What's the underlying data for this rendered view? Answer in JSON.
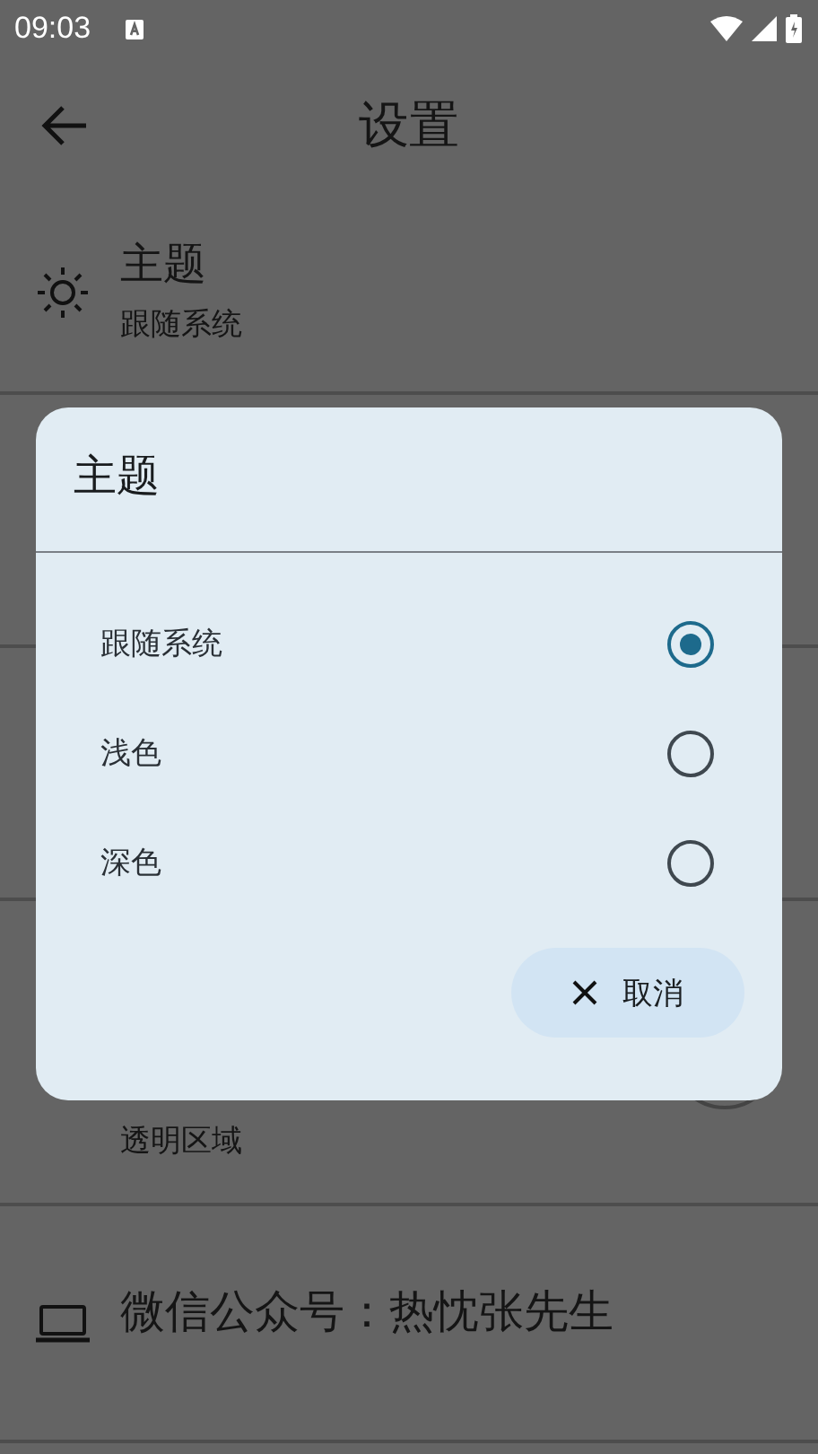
{
  "status_bar": {
    "time": "09:03"
  },
  "app_bar": {
    "title": "设置"
  },
  "settings": [
    {
      "kind": "entry",
      "title": "主题",
      "subtitle": "跟随系统"
    },
    {
      "kind": "covered"
    },
    {
      "kind": "covered"
    },
    {
      "kind": "partial",
      "subtitle": "透明区域"
    },
    {
      "kind": "info",
      "title": "微信公众号：热忱张先生"
    }
  ],
  "dialog": {
    "title": "主题",
    "options": [
      {
        "label": "跟随系统",
        "selected": true
      },
      {
        "label": "浅色",
        "selected": false
      },
      {
        "label": "深色",
        "selected": false
      }
    ],
    "cancel": "取消"
  }
}
